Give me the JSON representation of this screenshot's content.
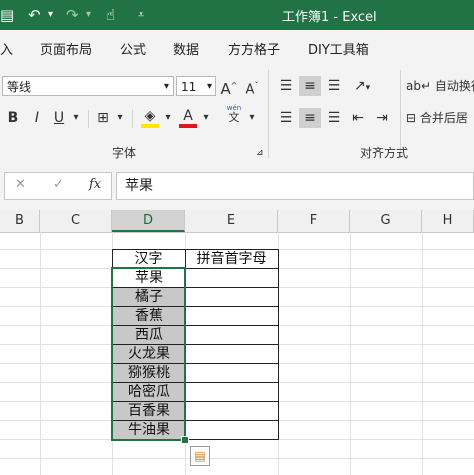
{
  "window": {
    "title": "工作簿1 - Excel",
    "quick_access": [
      "save-icon",
      "undo-icon",
      "redo-icon",
      "touch-mode-icon",
      "customize-icon"
    ]
  },
  "tabs": [
    "入",
    "页面布局",
    "公式",
    "数据",
    "方方格子",
    "DIY工具箱"
  ],
  "ribbon": {
    "font_name": "等线",
    "font_size": "11",
    "grow_font": "A",
    "shrink_font": "A",
    "bold": "B",
    "italic": "I",
    "underline": "U",
    "pinyin_label": "wén",
    "font_group_label": "字体",
    "align_group_label": "对齐方式",
    "wrap_text": "自动换行",
    "merge_center": "合并后居",
    "highlight_color": "#FFE600",
    "font_color": "#E0161A"
  },
  "formula_bar": {
    "cancel": "✕",
    "confirm": "✓",
    "fx": "fx",
    "value": "苹果"
  },
  "columns": [
    "B",
    "C",
    "D",
    "E",
    "F",
    "G",
    "H"
  ],
  "selected_column": "D",
  "table": {
    "header_d": "汉字",
    "header_e": "拼音首字母",
    "items": [
      "苹果",
      "橘子",
      "香蕉",
      "西瓜",
      "火龙果",
      "猕猴桃",
      "哈密瓜",
      "百香果",
      "牛油果"
    ]
  },
  "colors": {
    "excel_green": "#217346",
    "highlighted_cells": "#C8C8C8"
  }
}
